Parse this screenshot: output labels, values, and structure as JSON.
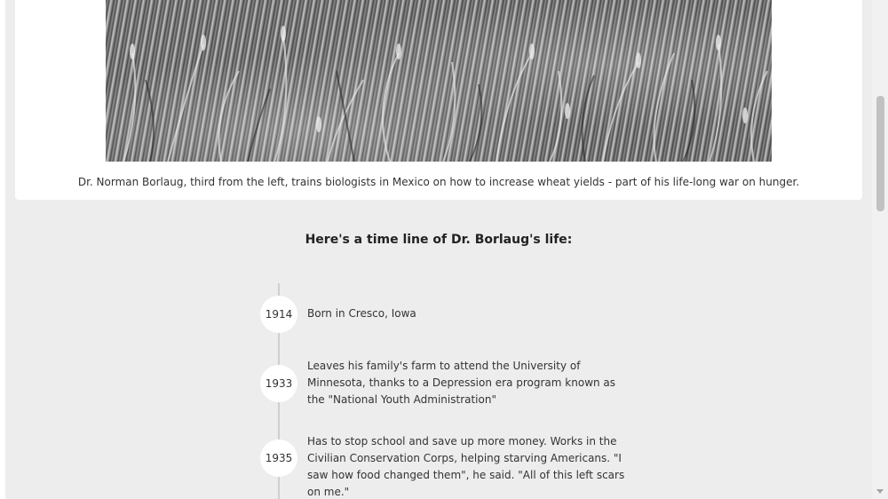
{
  "photo": {
    "alt": "Wheat field (black and white)",
    "caption": "Dr. Norman Borlaug, third from the left, trains biologists in Mexico on how to increase wheat yields - part of his life-long war on hunger."
  },
  "timeline": {
    "heading": "Here's a time line of Dr. Borlaug's life:",
    "events": [
      {
        "year": "1914",
        "text": "Born in Cresco, Iowa"
      },
      {
        "year": "1933",
        "text": "Leaves his family's farm to attend the University of Minnesota, thanks to a Depression era program known as the \"National Youth Administration\""
      },
      {
        "year": "1935",
        "text": "Has to stop school and save up more money. Works in the Civilian Conservation Corps, helping starving Americans. \"I saw how food changed them\", he said. \"All of this left scars on me.\""
      }
    ]
  },
  "scrollbar": {
    "position_fraction": 0.2
  }
}
